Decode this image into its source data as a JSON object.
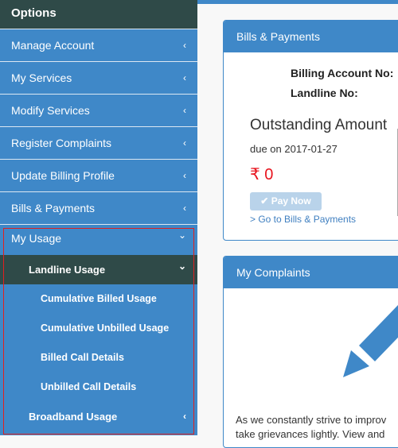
{
  "sidebar": {
    "header": "Options",
    "items": [
      {
        "label": "Manage Account",
        "icon": "chevron-left-icon"
      },
      {
        "label": "My Services",
        "icon": "chevron-left-icon"
      },
      {
        "label": "Modify Services",
        "icon": "chevron-left-icon"
      },
      {
        "label": "Register Complaints",
        "icon": "chevron-left-icon"
      },
      {
        "label": "Update Billing Profile",
        "icon": "chevron-left-icon"
      },
      {
        "label": "Bills & Payments",
        "icon": "chevron-left-icon"
      }
    ],
    "usage": {
      "label": "My Usage",
      "icon": "chevron-down-icon",
      "landline": {
        "label": "Landline Usage",
        "icon": "chevron-down-icon",
        "items": [
          "Cumulative Billed Usage",
          "Cumulative Unbilled Usage",
          "Billed Call Details",
          "Unbilled Call Details"
        ]
      },
      "broadband": {
        "label": "Broadband Usage",
        "icon": "chevron-left-icon"
      }
    },
    "chevron_left": "‹",
    "chevron_down": "⌄"
  },
  "bills": {
    "title": "Bills & Payments",
    "billing_account_label": "Billing Account No:",
    "landline_label": "Landline No:",
    "outstanding_title": "Outstanding Amount",
    "due_text": "due on 2017-01-27",
    "amount": "₹ 0",
    "pay_button": "Pay Now",
    "pay_icon": "✔",
    "goto_link": "> Go to Bills & Payments"
  },
  "complaints": {
    "title": "My Complaints",
    "text_line1": "As we constantly strive to improv",
    "text_line2": "take grievances lightly. View and"
  },
  "colors": {
    "primary": "#3f88c8",
    "dark": "#2f4a48",
    "amount": "#e8141e",
    "highlight_box": "#e02020"
  }
}
